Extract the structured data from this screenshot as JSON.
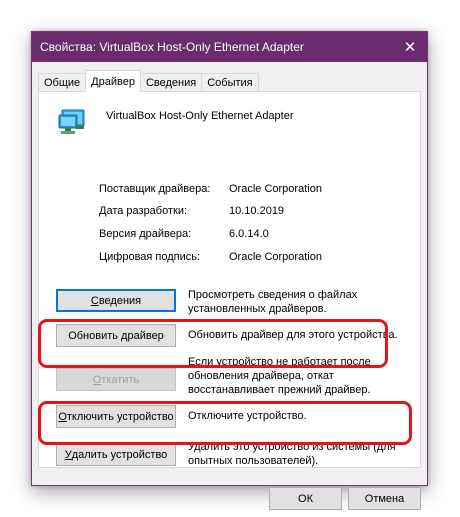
{
  "window": {
    "title": "Свойства: VirtualBox Host-Only Ethernet Adapter",
    "close_glyph": "✕"
  },
  "tabs": [
    {
      "label": "Общие",
      "active": false
    },
    {
      "label": "Драйвер",
      "active": true
    },
    {
      "label": "Сведения",
      "active": false
    },
    {
      "label": "События",
      "active": false
    }
  ],
  "device": {
    "icon": "network-adapter-icon",
    "name": "VirtualBox Host-Only Ethernet Adapter"
  },
  "properties": [
    {
      "label": "Поставщик драйвера:",
      "value": "Oracle Corporation"
    },
    {
      "label": "Дата разработки:",
      "value": "10.10.2019"
    },
    {
      "label": "Версия драйвера:",
      "value": "6.0.14.0"
    },
    {
      "label": "Цифровая подпись:",
      "value": "Oracle Corporation"
    }
  ],
  "actions": [
    {
      "label": "Сведения",
      "underline": "С",
      "rest": "ведения",
      "description": "Просмотреть сведения о файлах установленных драйверов.",
      "enabled": true,
      "focused": true
    },
    {
      "label": "Обновить драйвер",
      "underline": "",
      "rest": "Обновить драйвер",
      "description": "Обновить драйвер для этого устройства.",
      "enabled": true,
      "focused": false
    },
    {
      "label": "Откатить",
      "underline": "О",
      "rest": "ткатить",
      "description": "Если устройство не работает после обновления драйвера, откат восстанавливает прежний драйвер.",
      "enabled": false,
      "focused": false
    },
    {
      "label": "Отключить устройство",
      "underline": "О",
      "rest": "тключить устройство",
      "description": "Отключите устройство.",
      "enabled": true,
      "focused": false
    },
    {
      "label": "Удалить устройство",
      "underline": "У",
      "rest": "далить устройство",
      "description": "Удалить это устройство из системы (для опытных пользователей).",
      "enabled": true,
      "focused": false
    }
  ],
  "footer": {
    "ok_label": "ОК",
    "cancel_label": "Отмена"
  },
  "colors": {
    "titlebar": "#6b2c6f",
    "highlight": "#e4141a",
    "focus": "#0078d7"
  }
}
